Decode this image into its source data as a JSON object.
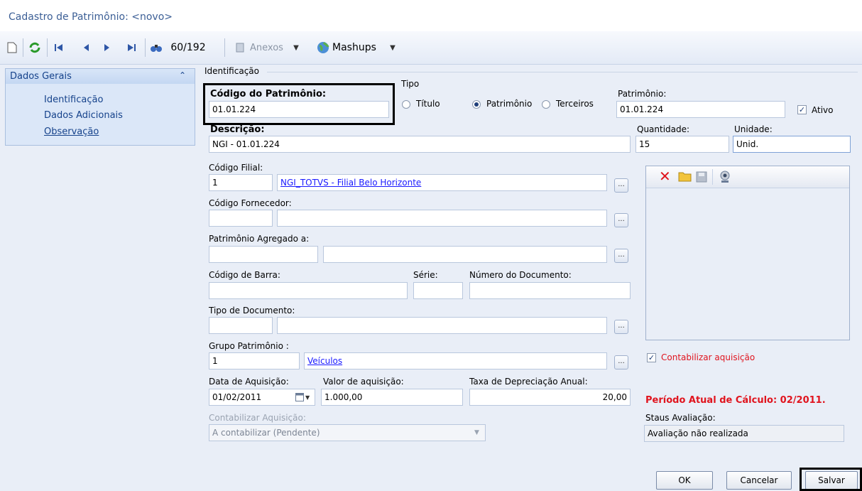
{
  "window": {
    "title": "Cadastro de Patrimônio: <novo>"
  },
  "toolbar": {
    "record_position": "60/192",
    "anexos_label": "Anexos",
    "mashups_label": "Mashups"
  },
  "nav": {
    "header": "Dados Gerais",
    "items": [
      {
        "label": "Identificação"
      },
      {
        "label": "Dados Adicionais"
      },
      {
        "label": "Observação"
      }
    ]
  },
  "form": {
    "group_label": "Identificação",
    "codigo_label": "Código do Patrimônio:",
    "codigo_value": "01.01.224",
    "tipo_label": "Tipo",
    "tipo_options": [
      "Título",
      "Patrimônio",
      "Terceiros"
    ],
    "tipo_selected": "Patrimônio",
    "patrimonio_label": "Patrimônio:",
    "patrimonio_value": "01.01.224",
    "ativo_label": "Ativo",
    "descricao_label": "Descrição:",
    "descricao_value": "NGI - 01.01.224",
    "quantidade_label": "Quantidade:",
    "quantidade_value": "15",
    "unidade_label": "Unidade:",
    "unidade_value": "Unid.",
    "codigo_filial_label": "Código Filial:",
    "codigo_filial_value": "1",
    "filial_name": "NGI_TOTVS - Filial Belo Horizonte",
    "codigo_fornecedor_label": "Código Fornecedor:",
    "agregado_label": "Patrimônio Agregado a:",
    "codigo_barra_label": "Código de Barra:",
    "serie_label": "Série:",
    "numero_documento_label": "Número do Documento:",
    "tipo_documento_label": "Tipo de Documento:",
    "grupo_label": "Grupo Patrimônio :",
    "grupo_value": "1",
    "grupo_name": "Veículos",
    "data_aquisicao_label": "Data de Aquisição:",
    "data_aquisicao_value": "01/02/2011",
    "valor_aquisicao_label": "Valor de aquisição:",
    "valor_aquisicao_value": "1.000,00",
    "taxa_label": "Taxa de Depreciação Anual:",
    "taxa_value": "20,00",
    "contabilizar_label": "Contabilizar Aquisição:",
    "contabilizar_value": "A contabilizar (Pendente)",
    "contabilizar_checkbox_label": "Contabilizar aquisição",
    "periodo_label": "Período Atual de Cálculo: 02/2011.",
    "status_label": "Staus Avaliação:",
    "status_value": "Avaliação não realizada"
  },
  "buttons": {
    "ok": "OK",
    "cancelar": "Cancelar",
    "salvar": "Salvar"
  },
  "colors": {
    "accent": "#15428b",
    "link": "#1a1aff",
    "warning": "#e0141e"
  }
}
